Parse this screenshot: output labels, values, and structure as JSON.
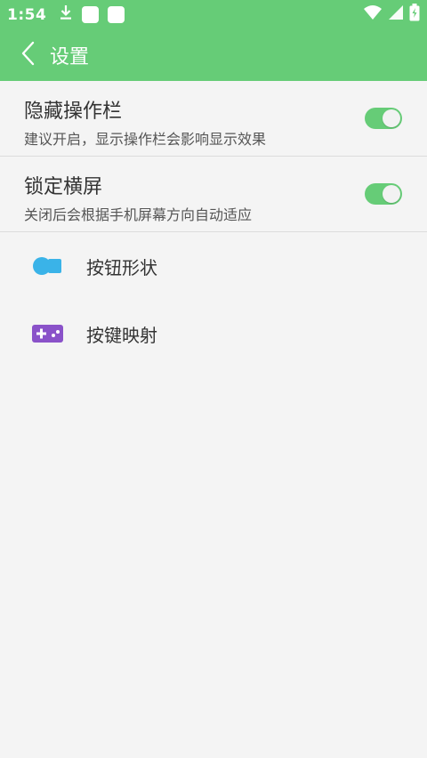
{
  "status_bar": {
    "time": "1:54",
    "icons": [
      "download-icon",
      "notification-icon",
      "notification-icon",
      "wifi-icon",
      "signal-icon",
      "battery-icon"
    ]
  },
  "appbar": {
    "back_icon": "chevron-left-icon",
    "title": "设置"
  },
  "settings": [
    {
      "title": "隐藏操作栏",
      "description": "建议开启，显示操作栏会影响显示效果",
      "enabled": true
    },
    {
      "title": "锁定横屏",
      "description": "关闭后会根据手机屏幕方向自动适应",
      "enabled": true
    }
  ],
  "menu": [
    {
      "label": "按钮形状",
      "icon": "button-shape-icon",
      "icon_color": "#3ab3e8"
    },
    {
      "label": "按键映射",
      "icon": "gamepad-icon",
      "icon_color": "#8a52c9"
    }
  ],
  "colors": {
    "accent": "#66cc77",
    "background": "#f4f4f4"
  }
}
